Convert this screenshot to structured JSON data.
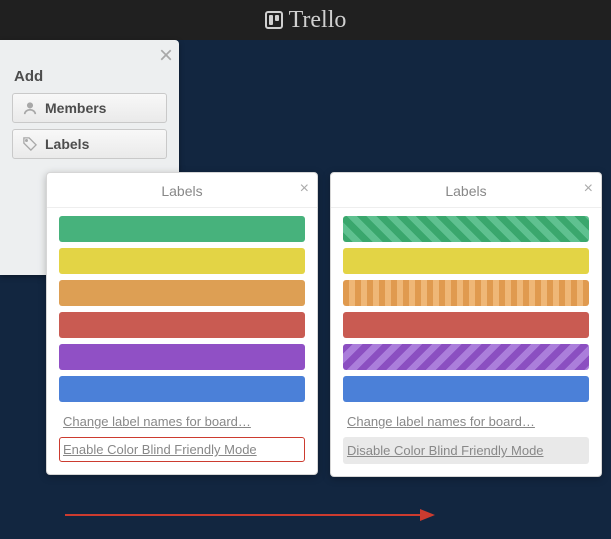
{
  "brand": {
    "name": "Trello"
  },
  "sidebar": {
    "section_title": "Add",
    "items": [
      {
        "label": "Members",
        "icon": "user-icon"
      },
      {
        "label": "Labels",
        "icon": "tag-icon"
      }
    ]
  },
  "labels_popover": {
    "title": "Labels",
    "colors": [
      {
        "name": "green",
        "hex": "#47b27c"
      },
      {
        "name": "yellow",
        "hex": "#e3d445"
      },
      {
        "name": "orange",
        "hex": "#dd9f54"
      },
      {
        "name": "red",
        "hex": "#c95b52"
      },
      {
        "name": "purple",
        "hex": "#9050c5"
      },
      {
        "name": "blue",
        "hex": "#4b80d8"
      }
    ],
    "change_names_label": "Change label names for board…",
    "enable_cb_label": "Enable Color Blind Friendly Mode",
    "disable_cb_label": "Disable Color Blind Friendly Mode",
    "cb_patterns": {
      "green": "diag-45",
      "yellow": "solid",
      "orange": "vert",
      "red": "solid",
      "purple": "diag-135",
      "blue": "solid"
    }
  },
  "annotation": {
    "arrow_color": "#cc3b2f"
  }
}
